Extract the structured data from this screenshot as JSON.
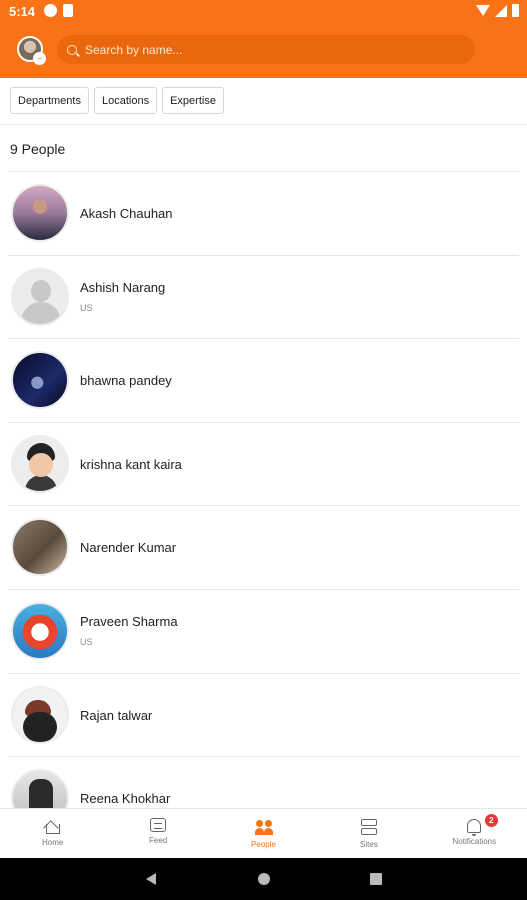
{
  "status_bar": {
    "time": "5:14"
  },
  "search": {
    "placeholder": "Search by name..."
  },
  "filters": [
    "Departments",
    "Locations",
    "Expertise"
  ],
  "people_count": "9 People",
  "people": [
    {
      "name": "Akash Chauhan",
      "sub": ""
    },
    {
      "name": "Ashish Narang",
      "sub": "US"
    },
    {
      "name": "bhawna pandey",
      "sub": ""
    },
    {
      "name": "krishna kant kaira",
      "sub": ""
    },
    {
      "name": "Narender Kumar",
      "sub": ""
    },
    {
      "name": "Praveen Sharma",
      "sub": "US"
    },
    {
      "name": "Rajan talwar",
      "sub": ""
    },
    {
      "name": "Reena Khokhar",
      "sub": ""
    }
  ],
  "bottom_nav": {
    "items": [
      {
        "label": "Home",
        "icon": "home-icon"
      },
      {
        "label": "Feed",
        "icon": "feed-icon"
      },
      {
        "label": "People",
        "icon": "people-icon"
      },
      {
        "label": "Sites",
        "icon": "sites-icon"
      },
      {
        "label": "Notifications",
        "icon": "bell-icon"
      }
    ],
    "notifications_badge": "2"
  },
  "colors": {
    "accent": "#f97316",
    "badge": "#e53935"
  }
}
